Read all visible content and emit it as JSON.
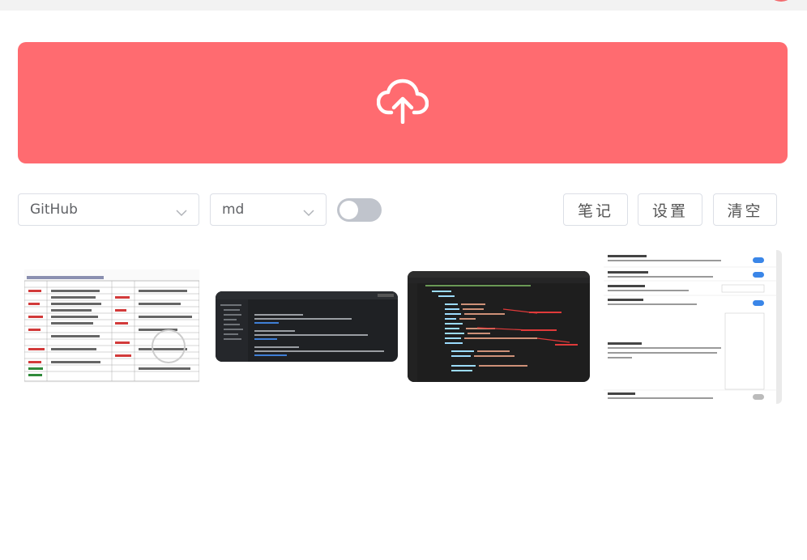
{
  "source_select": {
    "value": "GitHub",
    "icon": "chevron-down-icon"
  },
  "format_select": {
    "value": "md",
    "icon": "chevron-down-icon"
  },
  "toggle": {
    "on": false
  },
  "buttons": {
    "notes": "笔记",
    "settings": "设置",
    "clear": "清空"
  },
  "upload": {
    "icon": "cloud-upload-icon"
  },
  "colors": {
    "accent": "#ff6b70",
    "switch_off": "#c0c4cc",
    "border": "#dcdfe6"
  },
  "thumbnails": [
    {
      "kind": "keyword-table-screenshot"
    },
    {
      "kind": "dark-settings-screenshot"
    },
    {
      "kind": "dark-code-editor-screenshot"
    },
    {
      "kind": "settings-panel-screenshot"
    }
  ]
}
